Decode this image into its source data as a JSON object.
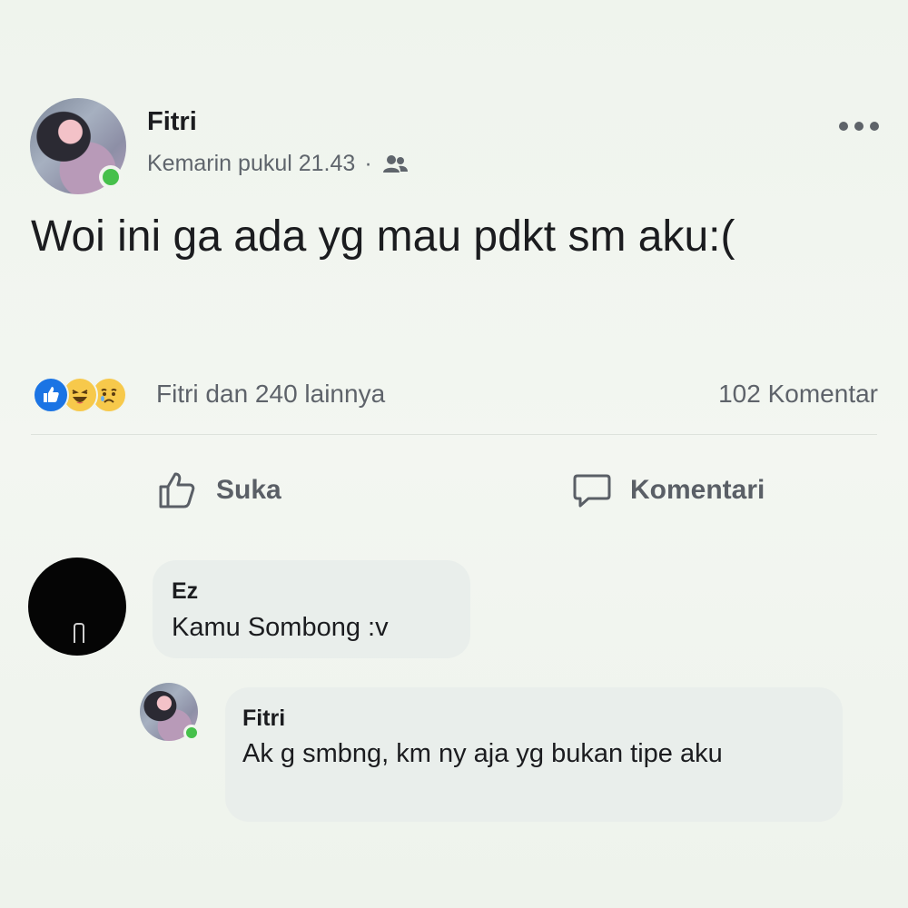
{
  "post": {
    "author": "Fitri",
    "timestamp": "Kemarin pukul 21.43",
    "separator": "·",
    "audience_icon": "friends-icon",
    "text": "Woi ini ga ada yg mau pdkt sm aku:(",
    "reactions": {
      "icons": [
        "like-reaction-icon",
        "haha-reaction-icon",
        "sad-reaction-icon"
      ],
      "summary": "Fitri dan 240 lainnya"
    },
    "comments_count": "102 Komentar"
  },
  "actions": {
    "like_label": "Suka",
    "comment_label": "Komentari"
  },
  "comments": [
    {
      "author": "Ez",
      "text": "Kamu Sombong :v"
    },
    {
      "author": "Fitri",
      "text": "Ak g smbng, km ny aja yg bukan tipe aku"
    }
  ],
  "colors": {
    "background": "#f1f5ef",
    "online": "#46c04b",
    "like_blue": "#1b74e4",
    "bubble": "#e9eeeb"
  }
}
